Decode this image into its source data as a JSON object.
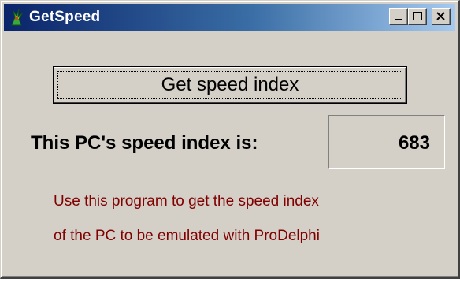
{
  "window": {
    "title": "GetSpeed",
    "icon": "delphi-app-icon",
    "controls": {
      "minimize": "minimize-icon",
      "maximize": "maximize-icon",
      "close": "close-icon"
    }
  },
  "main": {
    "button_label": "Get speed index",
    "speed_label": "This PC's speed index is:",
    "speed_value": "683",
    "info_line1": "Use this program to get the speed index",
    "info_line2": "of the PC to be emulated with ProDelphi"
  },
  "colors": {
    "face": "#d4d0c8",
    "title_start": "#0a246a",
    "title_end": "#a6caf0",
    "info_text": "#800000"
  }
}
